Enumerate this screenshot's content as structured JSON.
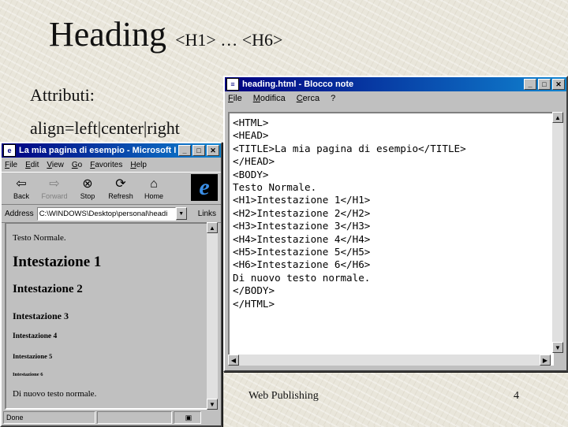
{
  "slide": {
    "title_main": "Heading",
    "title_sub": "<H1> … <H6>",
    "attributes_label": "Attributi:",
    "align_attr": "align=left|center|right",
    "footer_text": "Web Publishing",
    "page_number": "4"
  },
  "notepad": {
    "title": "heading.html - Blocco note",
    "menu": [
      "File",
      "Modifica",
      "Cerca",
      "?"
    ],
    "content": "<HTML>\n<HEAD>\n<TITLE>La mia pagina di esempio</TITLE>\n</HEAD>\n<BODY>\nTesto Normale.\n<H1>Intestazione 1</H1>\n<H2>Intestazione 2</H2>\n<H3>Intestazione 3</H3>\n<H4>Intestazione 4</H4>\n<H5>Intestazione 5</H5>\n<H6>Intestazione 6</H6>\nDi nuovo testo normale.\n</BODY>\n</HTML>"
  },
  "browser": {
    "title": "La mia pagina di esempio - Microsoft Inte",
    "menu": [
      "File",
      "Edit",
      "View",
      "Go",
      "Favorites",
      "Help"
    ],
    "toolbar": [
      {
        "label": "Back",
        "icon": "back-arrow-icon",
        "glyph": "⇦",
        "enabled": true
      },
      {
        "label": "Forward",
        "icon": "forward-arrow-icon",
        "glyph": "⇨",
        "enabled": false
      },
      {
        "label": "Stop",
        "icon": "stop-icon",
        "glyph": "⊗",
        "enabled": true
      },
      {
        "label": "Refresh",
        "icon": "refresh-icon",
        "glyph": "⟳",
        "enabled": true
      },
      {
        "label": "Home",
        "icon": "home-icon",
        "glyph": "⌂",
        "enabled": true
      }
    ],
    "address_label": "Address",
    "address_value": "C:\\WINDOWS\\Desktop\\personal\\headi",
    "links_label": "Links",
    "page": {
      "normal_text": "Testo Normale.",
      "h1": "Intestazione 1",
      "h2": "Intestazione 2",
      "h3": "Intestazione 3",
      "h4": "Intestazione 4",
      "h5": "Intestazione 5",
      "h6": "Intestazione 6",
      "normal_again": "Di nuovo testo normale."
    },
    "status_text": "Done"
  }
}
